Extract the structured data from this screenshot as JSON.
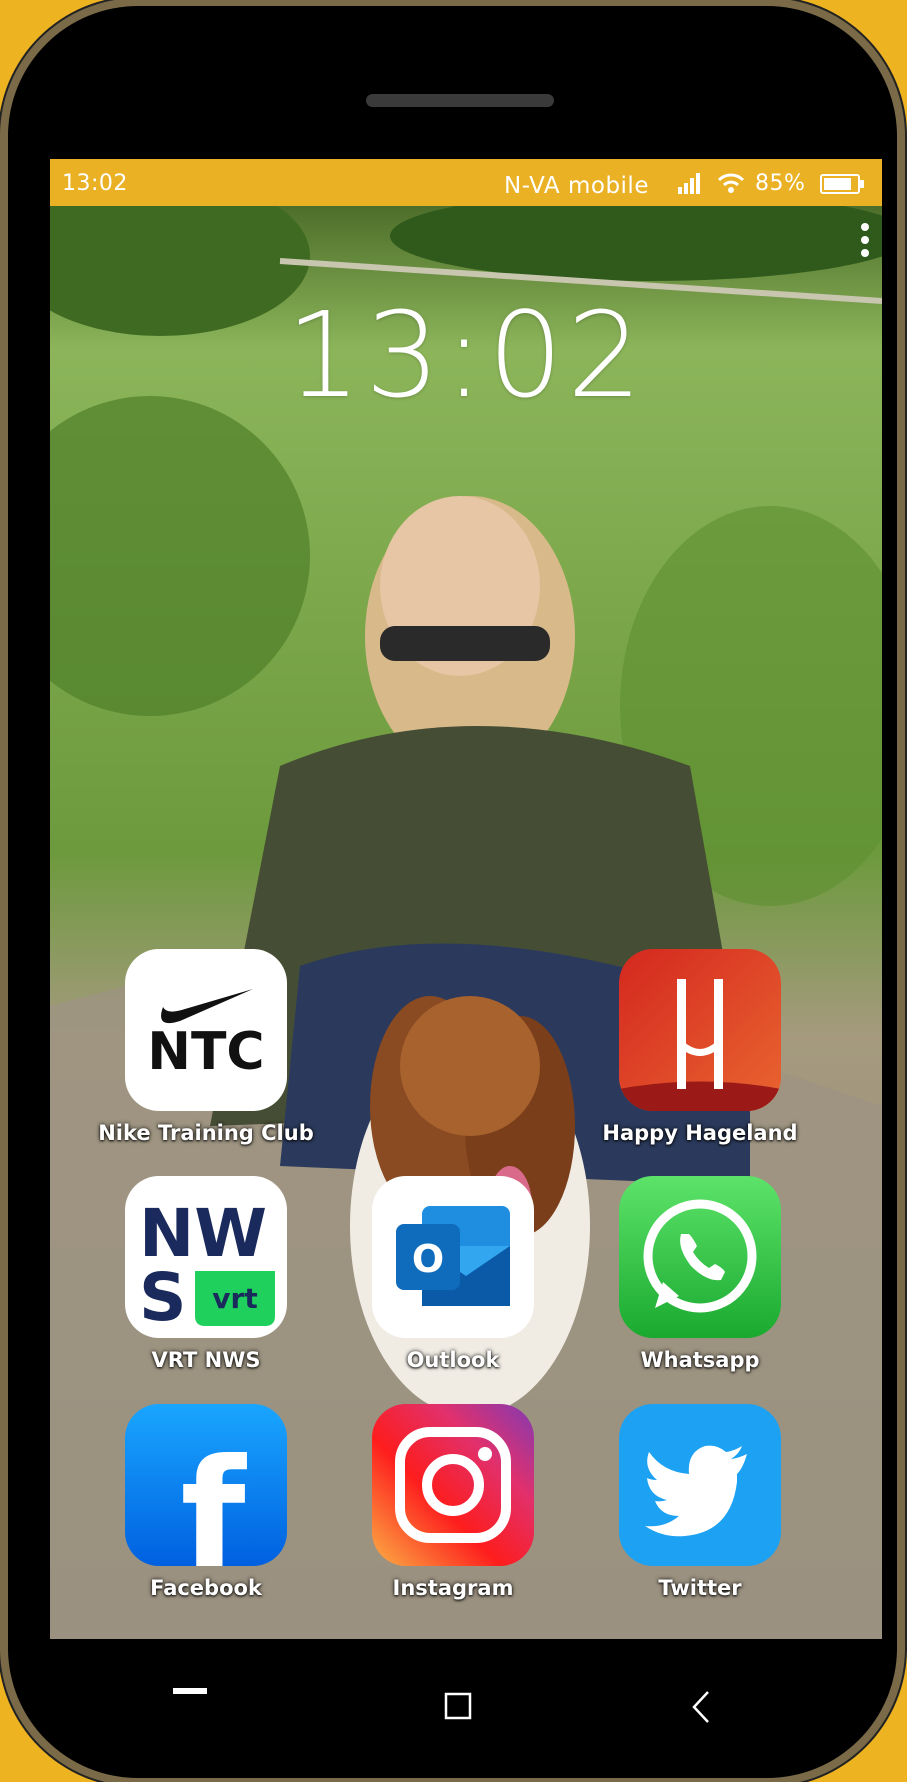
{
  "status_bar": {
    "time": "13:02",
    "carrier": "N-VA mobile",
    "battery_percent": "85%",
    "battery_level": 0.85,
    "accent_color": "#E9B123"
  },
  "lockscreen": {
    "clock": "13:02"
  },
  "apps": [
    {
      "label": "Nike Training Club",
      "icon": "nike-ntc-icon",
      "color": "#FFFFFF",
      "logo_text": "NTC"
    },
    {
      "label": "Happy Hageland",
      "icon": "happy-hageland-icon",
      "color": "#E3472A",
      "logo_text": "H"
    },
    {
      "label": "VRT NWS",
      "icon": "vrt-nws-icon",
      "color": "#FFFFFF",
      "logo_text_top": "NW",
      "logo_text_bottom": "S",
      "badge_text": "vrt"
    },
    {
      "label": "Outlook",
      "icon": "outlook-icon",
      "color": "#0F6CBD",
      "logo_text": "O"
    },
    {
      "label": "Whatsapp",
      "icon": "whatsapp-icon",
      "color": "#25D366"
    },
    {
      "label": "Facebook",
      "icon": "facebook-icon",
      "color": "#1877F2",
      "logo_text": "f"
    },
    {
      "label": "Instagram",
      "icon": "instagram-icon",
      "color": "#E1306C"
    },
    {
      "label": "Twitter",
      "icon": "twitter-icon",
      "color": "#1DA1F2"
    }
  ],
  "navigation": {
    "recent": "recent-apps-icon",
    "home": "home-icon",
    "back": "back-icon"
  },
  "colors": {
    "page_background": "#EDB320",
    "phone_body": "#000000"
  }
}
